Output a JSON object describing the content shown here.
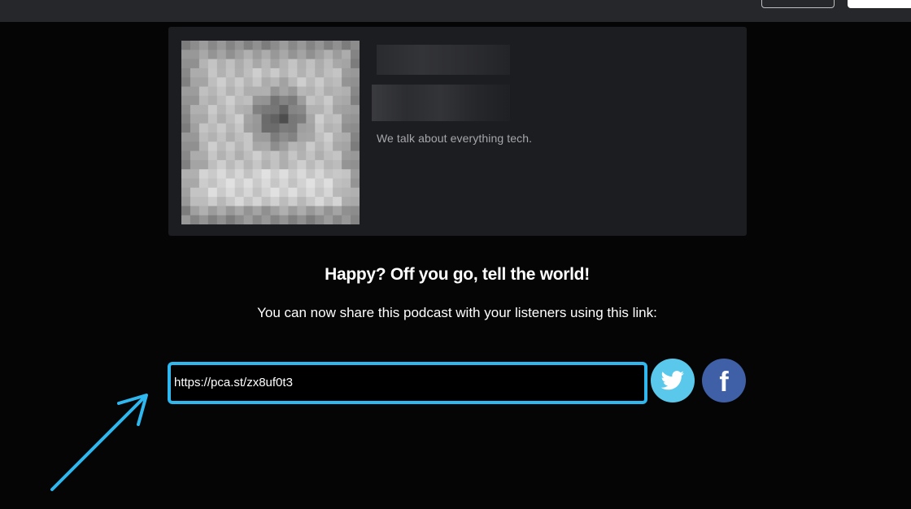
{
  "topbar": {
    "buttons": [
      "",
      ""
    ]
  },
  "podcast": {
    "description": "We talk about everything tech."
  },
  "share": {
    "headline": "Happy? Off you go, tell the world!",
    "instructions": "You can now share this podcast with your listeners using this link:",
    "link": "https://pca.st/zx8uf0t3"
  },
  "social": {
    "twitter_icon": "twitter-bird",
    "facebook_icon": "facebook-f"
  },
  "colors": {
    "accent": "#2fb7ef",
    "twitter": "#5ac8eb",
    "facebook": "#3f5fa6",
    "card": "#1c1d20"
  }
}
